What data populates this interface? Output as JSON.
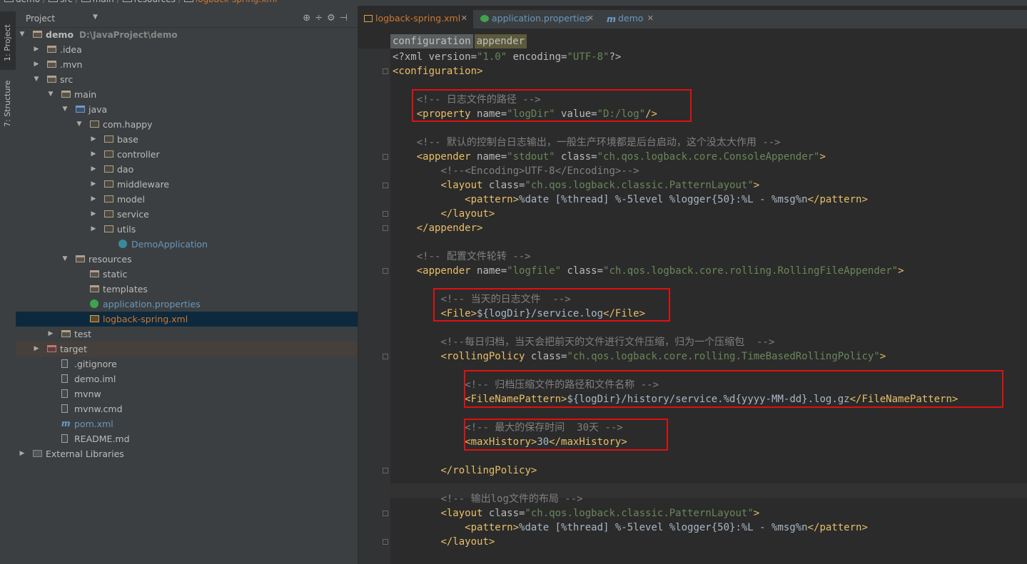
{
  "breadcrumb": [
    "demo",
    "src",
    "main",
    "resources",
    "logback-spring.xml"
  ],
  "sidebar_tabs": {
    "project": "1: Project",
    "structure": "7: Structure"
  },
  "project_panel": {
    "title": "Project",
    "tree": [
      {
        "label": "demo",
        "hint": "D:\\JavaProject\\demo",
        "depth": 0,
        "arrow": "down",
        "icon": "folder",
        "color": "default",
        "bold": true
      },
      {
        "label": ".idea",
        "depth": 1,
        "arrow": "right",
        "icon": "folder",
        "color": "default"
      },
      {
        "label": ".mvn",
        "depth": 1,
        "arrow": "right",
        "icon": "folder",
        "color": "default"
      },
      {
        "label": "src",
        "depth": 1,
        "arrow": "down",
        "icon": "folder",
        "color": "default"
      },
      {
        "label": "main",
        "depth": 2,
        "arrow": "down",
        "icon": "folder",
        "color": "default"
      },
      {
        "label": "java",
        "depth": 3,
        "arrow": "down",
        "icon": "folder-blue",
        "color": "default"
      },
      {
        "label": "com.happy",
        "depth": 4,
        "arrow": "down",
        "icon": "pkg",
        "color": "default"
      },
      {
        "label": "base",
        "depth": 5,
        "arrow": "right",
        "icon": "pkg",
        "color": "default"
      },
      {
        "label": "controller",
        "depth": 5,
        "arrow": "right",
        "icon": "pkg",
        "color": "default"
      },
      {
        "label": "dao",
        "depth": 5,
        "arrow": "right",
        "icon": "pkg",
        "color": "default"
      },
      {
        "label": "middleware",
        "depth": 5,
        "arrow": "right",
        "icon": "pkg",
        "color": "default"
      },
      {
        "label": "model",
        "depth": 5,
        "arrow": "right",
        "icon": "pkg",
        "color": "default"
      },
      {
        "label": "service",
        "depth": 5,
        "arrow": "right",
        "icon": "pkg",
        "color": "default"
      },
      {
        "label": "utils",
        "depth": 5,
        "arrow": "right",
        "icon": "pkg",
        "color": "default"
      },
      {
        "label": "DemoApplication",
        "depth": 6,
        "arrow": "",
        "icon": "class",
        "color": "blue"
      },
      {
        "label": "resources",
        "depth": 3,
        "arrow": "down",
        "icon": "folder",
        "color": "default"
      },
      {
        "label": "static",
        "depth": 4,
        "arrow": "",
        "icon": "folder",
        "color": "default"
      },
      {
        "label": "templates",
        "depth": 4,
        "arrow": "",
        "icon": "folder",
        "color": "default"
      },
      {
        "label": "application.properties",
        "depth": 4,
        "arrow": "",
        "icon": "spring",
        "color": "blue"
      },
      {
        "label": "logback-spring.xml",
        "depth": 4,
        "arrow": "",
        "icon": "xml",
        "color": "red",
        "selected": true
      },
      {
        "label": "test",
        "depth": 2,
        "arrow": "right",
        "icon": "folder",
        "color": "default"
      },
      {
        "label": "target",
        "depth": 1,
        "arrow": "right",
        "icon": "folder-red",
        "color": "default",
        "highlighted": true
      },
      {
        "label": ".gitignore",
        "depth": 2,
        "arrow": "",
        "icon": "file",
        "color": "default"
      },
      {
        "label": "demo.iml",
        "depth": 2,
        "arrow": "",
        "icon": "file",
        "color": "default"
      },
      {
        "label": "mvnw",
        "depth": 2,
        "arrow": "",
        "icon": "file",
        "color": "default"
      },
      {
        "label": "mvnw.cmd",
        "depth": 2,
        "arrow": "",
        "icon": "file",
        "color": "default"
      },
      {
        "label": "pom.xml",
        "depth": 2,
        "arrow": "",
        "icon": "mvn",
        "color": "blue"
      },
      {
        "label": "README.md",
        "depth": 2,
        "arrow": "",
        "icon": "file",
        "color": "default"
      },
      {
        "label": "External Libraries",
        "depth": 0,
        "arrow": "right",
        "icon": "libs",
        "color": "default"
      }
    ]
  },
  "tabs": [
    {
      "id": "tab-logback",
      "label": "logback-spring.xml",
      "active": true
    },
    {
      "id": "tab-app",
      "label": "application.properties",
      "active": false
    },
    {
      "id": "tab-demo",
      "label": "demo",
      "active": false
    }
  ],
  "xml_breadcrumb": [
    "configuration",
    "appender"
  ],
  "code_lines": [
    [
      [
        "pi",
        "<?xml version="
      ],
      [
        "val",
        "\"1.0\""
      ],
      [
        "pi",
        " encoding="
      ],
      [
        "val",
        "\"UTF-8\""
      ],
      [
        "pi",
        "?>"
      ]
    ],
    [
      [
        "tag",
        "<configuration>"
      ]
    ],
    [],
    [
      [
        "sp",
        "    "
      ],
      [
        "com",
        "<!-- 日志文件的路径 -->"
      ]
    ],
    [
      [
        "sp",
        "    "
      ],
      [
        "tag",
        "<property "
      ],
      [
        "attr",
        "name="
      ],
      [
        "val",
        "\"logDir\""
      ],
      [
        "attr",
        " value="
      ],
      [
        "val",
        "\"D:/log\""
      ],
      [
        "tag",
        "/>"
      ]
    ],
    [],
    [
      [
        "sp",
        "    "
      ],
      [
        "com",
        "<!-- 默认的控制台日志输出，一般生产环境都是后台启动，这个没太大作用 -->"
      ]
    ],
    [
      [
        "sp",
        "    "
      ],
      [
        "tag",
        "<appender "
      ],
      [
        "attr",
        "name="
      ],
      [
        "val",
        "\"stdout\""
      ],
      [
        "attr",
        " class="
      ],
      [
        "val",
        "\"ch.qos.logback.core.ConsoleAppender\""
      ],
      [
        "tag",
        ">"
      ]
    ],
    [
      [
        "sp",
        "        "
      ],
      [
        "com",
        "<!--<Encoding>UTF-8</Encoding>-->"
      ]
    ],
    [
      [
        "sp",
        "        "
      ],
      [
        "tag",
        "<layout "
      ],
      [
        "attr",
        "class="
      ],
      [
        "val",
        "\"ch.qos.logback.classic.PatternLayout\""
      ],
      [
        "tag",
        ">"
      ]
    ],
    [
      [
        "sp",
        "            "
      ],
      [
        "tag",
        "<pattern>"
      ],
      [
        "text",
        "%date [%thread] %-5level %logger{50}:%L - %msg%n"
      ],
      [
        "tag",
        "</pattern>"
      ]
    ],
    [
      [
        "sp",
        "        "
      ],
      [
        "tag",
        "</layout>"
      ]
    ],
    [
      [
        "sp",
        "    "
      ],
      [
        "tag",
        "</appender>"
      ]
    ],
    [],
    [
      [
        "sp",
        "    "
      ],
      [
        "com",
        "<!-- 配置文件轮转 -->"
      ]
    ],
    [
      [
        "sp",
        "    "
      ],
      [
        "tag",
        "<appender "
      ],
      [
        "attr",
        "name="
      ],
      [
        "val",
        "\"logfile\""
      ],
      [
        "attr",
        " class="
      ],
      [
        "val",
        "\"ch.qos.logback.core.rolling.RollingFileAppender\""
      ],
      [
        "tag",
        ">"
      ]
    ],
    [],
    [
      [
        "sp",
        "        "
      ],
      [
        "com",
        "<!-- 当天的日志文件  -->"
      ]
    ],
    [
      [
        "sp",
        "        "
      ],
      [
        "tag",
        "<File>"
      ],
      [
        "text",
        "${logDir}/service.log"
      ],
      [
        "tag",
        "</File>"
      ]
    ],
    [],
    [
      [
        "sp",
        "        "
      ],
      [
        "com",
        "<!--每日归档，当天会把前天的文件进行文件压缩，归为一个压缩包  -->"
      ]
    ],
    [
      [
        "sp",
        "        "
      ],
      [
        "tag",
        "<rollingPolicy "
      ],
      [
        "attr",
        "class="
      ],
      [
        "val",
        "\"ch.qos.logback.core.rolling.TimeBasedRollingPolicy\""
      ],
      [
        "tag",
        ">"
      ]
    ],
    [],
    [
      [
        "sp",
        "            "
      ],
      [
        "com",
        "<!-- 归档压缩文件的路径和文件名称 -->"
      ]
    ],
    [
      [
        "sp",
        "            "
      ],
      [
        "tag",
        "<FileNamePattern>"
      ],
      [
        "text",
        "${logDir}/history/service.%d{yyyy-MM-dd}.log.gz"
      ],
      [
        "tag",
        "</FileNamePattern>"
      ]
    ],
    [],
    [
      [
        "sp",
        "            "
      ],
      [
        "com",
        "<!-- 最大的保存时间  30天 -->"
      ]
    ],
    [
      [
        "sp",
        "            "
      ],
      [
        "tag",
        "<maxHistory>"
      ],
      [
        "text",
        "30"
      ],
      [
        "tag",
        "</maxHistory>"
      ]
    ],
    [],
    [
      [
        "sp",
        "        "
      ],
      [
        "tag",
        "</rollingPolicy>"
      ]
    ],
    [],
    [
      [
        "sp",
        "        "
      ],
      [
        "com",
        "<!-- 输出log文件的布局 -->"
      ]
    ],
    [
      [
        "sp",
        "        "
      ],
      [
        "tag",
        "<layout "
      ],
      [
        "attr",
        "class="
      ],
      [
        "val",
        "\"ch.qos.logback.classic.PatternLayout\""
      ],
      [
        "tag",
        ">"
      ]
    ],
    [
      [
        "sp",
        "            "
      ],
      [
        "tag",
        "<pattern>"
      ],
      [
        "text",
        "%date [%thread] %-5level %logger{50}:%L - %msg%n"
      ],
      [
        "tag",
        "</pattern>"
      ]
    ],
    [
      [
        "sp",
        "        "
      ],
      [
        "tag",
        "</layout>"
      ]
    ]
  ]
}
